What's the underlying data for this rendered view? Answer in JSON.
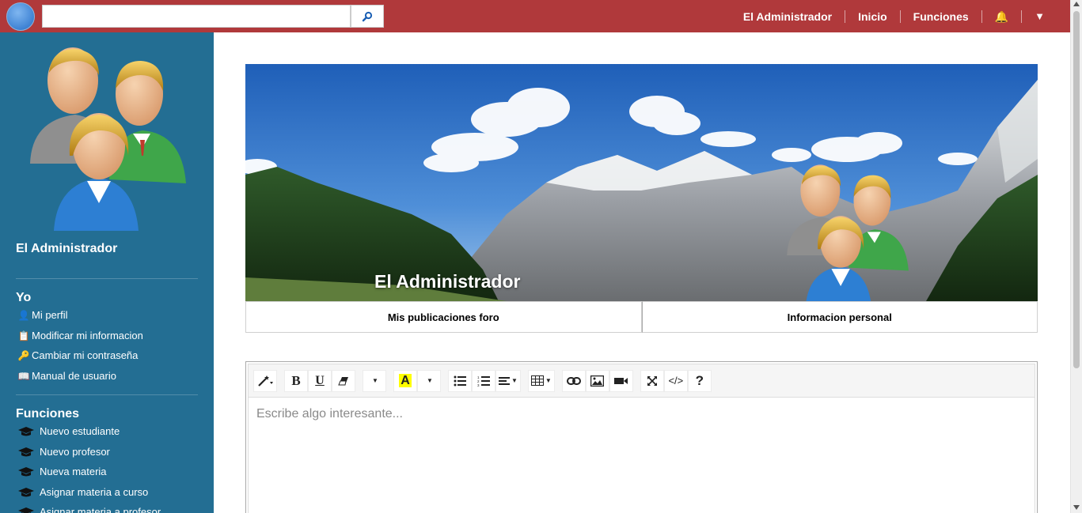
{
  "topbar": {
    "search_placeholder": "",
    "search_icon": "search-icon",
    "nav": [
      {
        "label": "El Administrador"
      },
      {
        "label": "Inicio"
      },
      {
        "label": "Funciones"
      }
    ],
    "bell_glyph": "🔔",
    "menu_caret": "▼"
  },
  "sidebar": {
    "name": "El Administrador",
    "sections": [
      {
        "title": "Yo",
        "items": [
          {
            "label": "Mi perfil",
            "icon": "user-icon",
            "glyph": "👤"
          },
          {
            "label": "Modificar mi informacion",
            "icon": "clipboard-icon",
            "glyph": "📋"
          },
          {
            "label": "Cambiar mi contraseña",
            "icon": "key-icon",
            "glyph": "🔑"
          },
          {
            "label": "Manual de usuario",
            "icon": "book-icon",
            "glyph": "📖"
          }
        ]
      },
      {
        "title": "Funciones",
        "items": [
          {
            "label": "Nuevo estudiante",
            "icon": "graduation-cap-icon"
          },
          {
            "label": "Nuevo profesor",
            "icon": "graduation-cap-icon"
          },
          {
            "label": "Nueva materia",
            "icon": "graduation-cap-icon"
          },
          {
            "label": "Asignar materia a curso",
            "icon": "graduation-cap-icon"
          },
          {
            "label": "Asignar materia a profesor",
            "icon": "graduation-cap-icon"
          }
        ]
      }
    ]
  },
  "profile": {
    "banner_name": "El Administrador",
    "tabs": [
      {
        "label": "Mis publicaciones foro"
      },
      {
        "label": "Informacion personal"
      }
    ]
  },
  "editor": {
    "placeholder": "Escribe algo interesante...",
    "toolbar": [
      {
        "name": "magic-style-button",
        "icon": "magic-wand-icon"
      },
      {
        "name": "bold-button",
        "icon": "bold-icon",
        "glyph": "B"
      },
      {
        "name": "underline-button",
        "icon": "underline-icon",
        "glyph": "U"
      },
      {
        "name": "eraser-button",
        "icon": "eraser-icon"
      },
      {
        "name": "font-dropdown",
        "icon": "caret-icon"
      },
      {
        "name": "text-color-button",
        "icon": "highlight-color-icon",
        "glyph": "A"
      },
      {
        "name": "unordered-list-button",
        "icon": "unordered-list-icon"
      },
      {
        "name": "ordered-list-button",
        "icon": "ordered-list-icon"
      },
      {
        "name": "paragraph-button",
        "icon": "align-left-icon"
      },
      {
        "name": "table-button",
        "icon": "table-icon"
      },
      {
        "name": "link-button",
        "icon": "link-icon"
      },
      {
        "name": "picture-button",
        "icon": "picture-icon"
      },
      {
        "name": "video-button",
        "icon": "video-icon"
      },
      {
        "name": "fullscreen-button",
        "icon": "fullscreen-icon"
      },
      {
        "name": "codeview-button",
        "icon": "code-icon",
        "glyph": "</>"
      },
      {
        "name": "help-button",
        "icon": "help-icon",
        "glyph": "?"
      }
    ]
  },
  "colors": {
    "topbar": "#b0393b",
    "sidebar": "#236e93",
    "highlight_yellow": "#ffff00"
  }
}
